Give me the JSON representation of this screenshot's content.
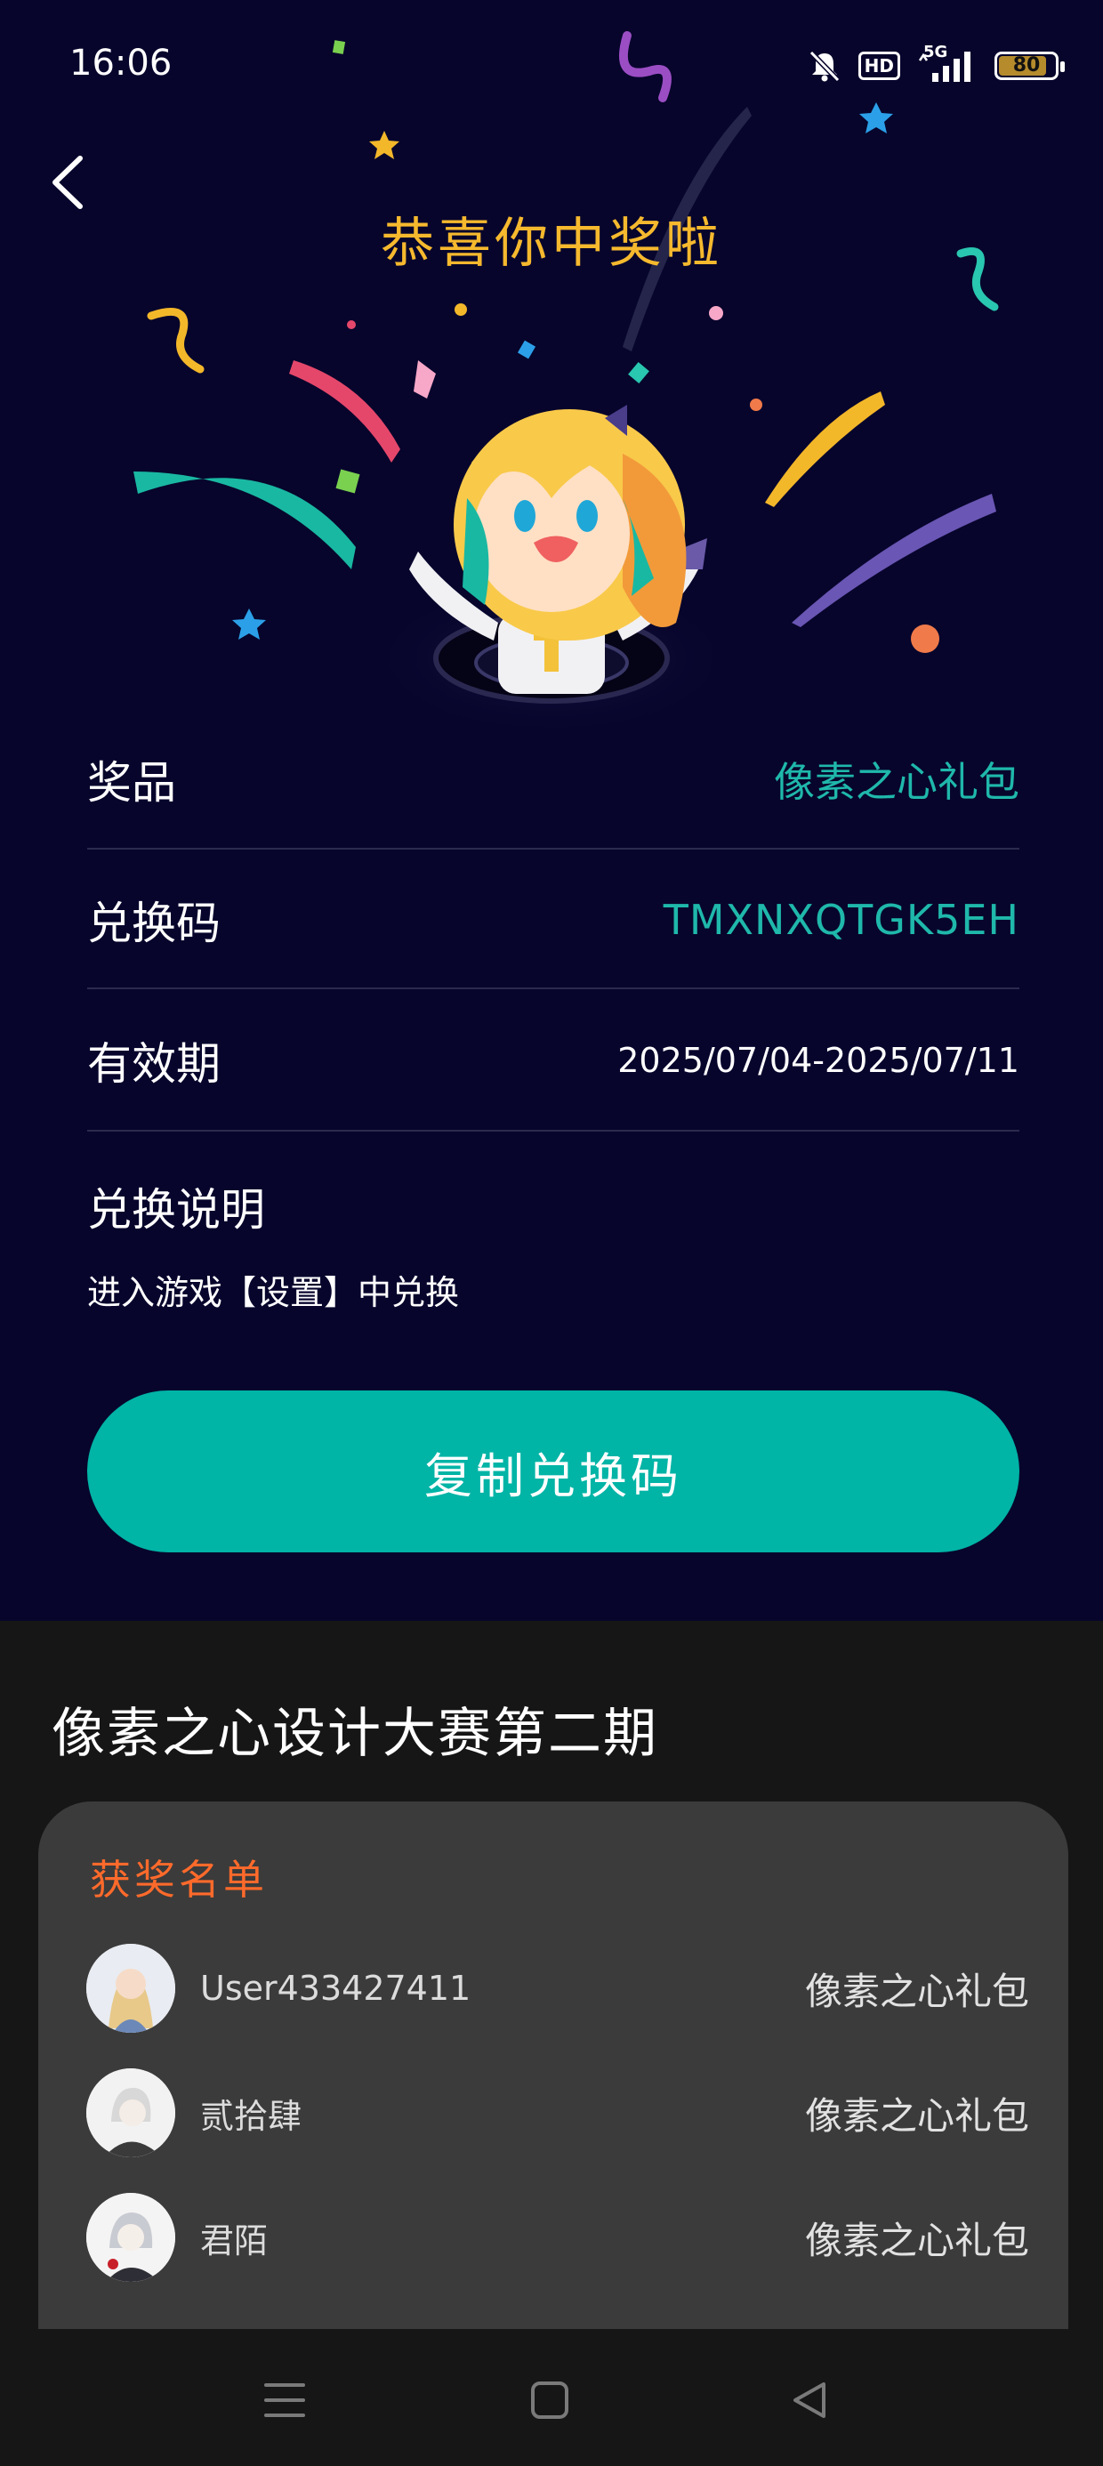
{
  "status_bar": {
    "time": "16:06",
    "hd_label": "HD",
    "network_label": "5G",
    "battery_level": "80",
    "icons": [
      "mute-bell-icon",
      "hd-icon",
      "signal-5g-icon",
      "battery-icon"
    ]
  },
  "header": {
    "back_icon": "chevron-left-icon",
    "title": "恭喜你中奖啦"
  },
  "prize_info": {
    "prize_label": "奖品",
    "prize_value": "像素之心礼包",
    "code_label": "兑换码",
    "code_value": "TMXNXQTGK5EH",
    "validity_label": "有效期",
    "validity_value": "2025/07/04-2025/07/11",
    "instructions_title": "兑换说明",
    "instructions_text": "进入游戏【设置】中兑换"
  },
  "copy_button_label": "复制兑换码",
  "event": {
    "title": "像素之心设计大赛第二期",
    "winners_title": "获奖名单",
    "winners": [
      {
        "name": "User433427411",
        "prize": "像素之心礼包"
      },
      {
        "name": "贰拾肆",
        "prize": "像素之心礼包"
      },
      {
        "name": "君陌",
        "prize": "像素之心礼包"
      }
    ]
  },
  "colors": {
    "background_top": "#07052c",
    "accent_teal": "#00b4a6",
    "value_teal": "#1fb8ab",
    "title_gold": "#f6b92e",
    "winners_title": "#ff6a2b",
    "card_bg": "#3b3b3b",
    "page_bottom": "#161616"
  },
  "nav_bar": {
    "icons": [
      "menu-icon",
      "home-square-icon",
      "back-triangle-icon"
    ]
  }
}
